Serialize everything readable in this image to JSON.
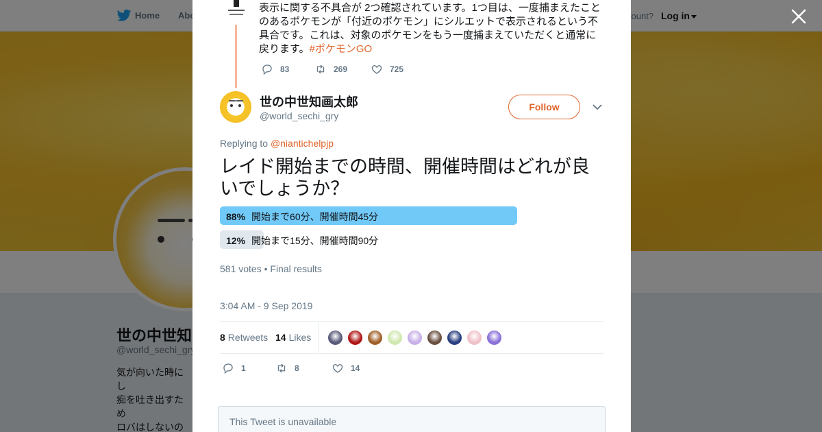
{
  "topnav": {
    "home_label": "Home",
    "about_label": "Abo",
    "account_question": "count?",
    "login_label": "Log in"
  },
  "profile": {
    "display_name": "世の中世知",
    "handle": "@world_sechi_gry",
    "bio": "気が向いた時にし\n痴を吐き出すため\nロバはしないので\nださい。フォロー\nす。ツイートやリ"
  },
  "parent_tweet": {
    "text": "表示に関する不具合が 2つ確認されています。1つ目は、一度捕まえたことのあるポケモンが「付近のポケモン」にシルエットで表示されるという不具合です。これは、対象のポケモンをもう一度捕まえていただくと通常に戻ります。",
    "hashtag": "#ポケモンGO",
    "replies": "83",
    "retweets": "269",
    "likes": "725"
  },
  "tweet": {
    "author_name": "世の中世知画太郎",
    "author_handle": "@world_sechi_gry",
    "follow_label": "Follow",
    "replying_prefix": "Replying to",
    "replying_mention": "@niantichelpjp",
    "text": "レイド開始までの時間、開催時間はどれが良いでしょうか？",
    "poll": {
      "options": [
        {
          "percent": "88%",
          "fraction": 0.88,
          "label": "開始まで60分、開催時間45分",
          "winner": true
        },
        {
          "percent": "12%",
          "fraction": 0.12,
          "label": "開始まで15分、開催時間90分",
          "winner": false
        }
      ],
      "meta": "581 votes • Final results"
    },
    "timestamp": "3:04 AM - 9 Sep 2019",
    "retweet_count": "8",
    "retweet_label": "Retweets",
    "like_count": "14",
    "like_label": "Likes",
    "likers": [
      "#5a5a7a",
      "#b01818",
      "#a0602a",
      "#cfe8b0",
      "#c8b0e8",
      "#6a5040",
      "#2a3f80",
      "#f0c0c8",
      "#8a70d8"
    ],
    "action_replies": "1",
    "action_retweets": "8",
    "action_likes": "14",
    "unavailable_text": "This Tweet is unavailable"
  },
  "colors": {
    "accent": "#e0662c",
    "poll_winner": "#71c9f8",
    "poll_other": "#e1e8ed",
    "thread_line": "#f6b79d"
  },
  "icons": [
    "twitter-bird-icon",
    "close-icon",
    "reply-icon",
    "retweet-icon",
    "like-icon",
    "chevron-down-icon"
  ]
}
